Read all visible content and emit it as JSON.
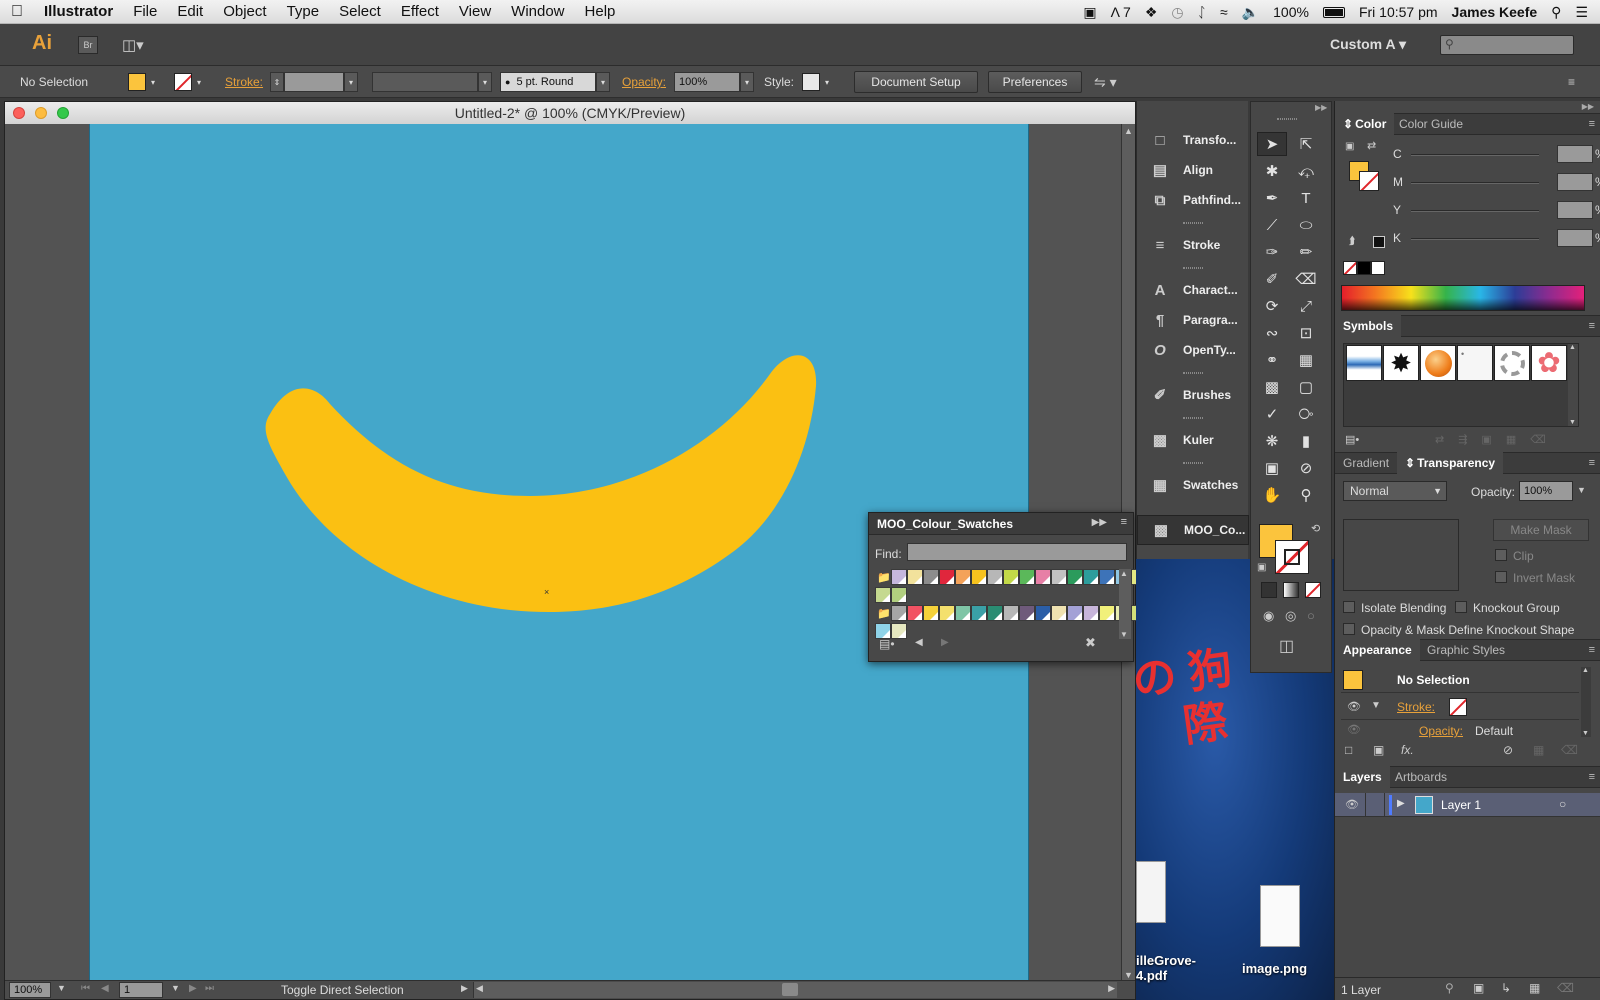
{
  "menubar": {
    "app_name": "Illustrator",
    "menus": [
      "File",
      "Edit",
      "Object",
      "Type",
      "Select",
      "Effect",
      "View",
      "Window",
      "Help"
    ],
    "status": {
      "adobe_count": "7",
      "battery": "100%",
      "clock": "Fri 10:57 pm",
      "user": "James Keefe"
    }
  },
  "appbar": {
    "logo": "Ai",
    "bridge": "Br",
    "workspace": "Custom A",
    "search_placeholder": ""
  },
  "control": {
    "selection": "No Selection",
    "stroke_label": "Stroke:",
    "brush": "5 pt. Round",
    "opacity_label": "Opacity:",
    "opacity_value": "100%",
    "style_label": "Style:",
    "doc_setup": "Document Setup",
    "preferences": "Preferences"
  },
  "document": {
    "title": "Untitled-2* @ 100% (CMYK/Preview)",
    "zoom": "100%",
    "artboard_num": "1",
    "status_text": "Toggle Direct Selection",
    "artboard_color": "#44a7ca",
    "shape_color": "#fbc012"
  },
  "dock": {
    "items": [
      "Transfo...",
      "Align",
      "Pathfind...",
      "Stroke",
      "Charact...",
      "Paragra...",
      "OpenTy...",
      "Brushes",
      "Kuler",
      "Swatches",
      "MOO_Co..."
    ]
  },
  "swatch_panel": {
    "title": "MOO_Colour_Swatches",
    "find_label": "Find:",
    "row1": [
      "#c6b7dd",
      "#f2e29c",
      "#8c8c8c",
      "#e0263c",
      "#f4a259",
      "#f7c31e",
      "#b7b7b7",
      "#c3d948",
      "#5bb85a",
      "#e77fa6",
      "#c2c2c2",
      "#2b9b5c",
      "#2d9d9c",
      "#3d73b8",
      "#8ec6e4",
      "#e2e883",
      "#9ad0ea",
      "#6f3c75"
    ],
    "row2": [
      "#c5d98f",
      "#b1cf7f"
    ],
    "row3": [
      "#a6a6a6",
      "#f25263",
      "#f6d23a",
      "#f4e06d",
      "#7fc5a6",
      "#3aa0a6",
      "#2a8c72",
      "#b7b7b7",
      "#6f5a7b",
      "#2b5ea7",
      "#efe2b0",
      "#a3a1d6",
      "#c7b5da",
      "#f1f07a",
      "#e7ecb0",
      "#d2e07a"
    ],
    "row4": [
      "#8fd3e8",
      "#e6e8c0"
    ]
  },
  "color_panel": {
    "tab_active": "Color",
    "tab_inactive": "Color Guide",
    "channels": [
      "C",
      "M",
      "Y",
      "K"
    ],
    "pct": "%"
  },
  "symbols_panel": {
    "title": "Symbols",
    "symbols": [
      "blue-brush-symbol",
      "ink-splat-symbol",
      "orange-sphere-symbol",
      "torn-paper-symbol",
      "chain-ring-symbol",
      "pink-flower-symbol"
    ]
  },
  "transparency_panel": {
    "tab_inactive": "Gradient",
    "tab_active": "Transparency",
    "blend_mode": "Normal",
    "opacity_label": "Opacity:",
    "opacity_value": "100%",
    "make_mask": "Make Mask",
    "clip": "Clip",
    "invert_mask": "Invert Mask",
    "isolate": "Isolate Blending",
    "knockout": "Knockout Group",
    "opacity_mask": "Opacity & Mask Define Knockout Shape"
  },
  "appearance_panel": {
    "tab_active": "Appearance",
    "tab_inactive": "Graphic Styles",
    "selection": "No Selection",
    "stroke_label": "Stroke:",
    "opacity_label": "Opacity:",
    "opacity_value": "Default"
  },
  "layers_panel": {
    "tab_active": "Layers",
    "tab_inactive": "Artboards",
    "layer_name": "Layer 1",
    "count": "1 Layer"
  },
  "desktop": {
    "file1": "illeGrove-\n4.pdf",
    "file2": "image.png"
  },
  "colors": {
    "fill": "#fbc43d",
    "ui_orange": "#e8a13a"
  }
}
